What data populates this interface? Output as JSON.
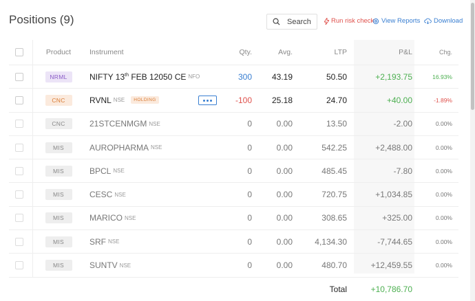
{
  "header": {
    "title": "Positions (9)",
    "search_label": "Search",
    "risk_label": "Run risk check",
    "reports_label": "View Reports",
    "download_label": "Download"
  },
  "columns": {
    "product": "Product",
    "instrument": "Instrument",
    "qty": "Qty.",
    "avg": "Avg.",
    "ltp": "LTP",
    "pnl": "P&L",
    "chg": "Chg."
  },
  "rows": [
    {
      "product": "NRML",
      "instrument": "NIFTY 13",
      "instrument_sup": "th",
      "instrument_rest": " FEB 12050 CE",
      "exchange": "NFO",
      "qty": "300",
      "avg": "43.19",
      "ltp": "50.50",
      "pnl": "+2,193.75",
      "chg": "16.93%"
    },
    {
      "product": "CNC",
      "instrument": "RVNL",
      "exchange": "NSE",
      "tag": "HOLDING",
      "qty": "-100",
      "avg": "25.18",
      "ltp": "24.70",
      "pnl": "+40.00",
      "chg": "-1.89%"
    },
    {
      "product": "CNC",
      "instrument": "21STCENMGM",
      "exchange": "NSE",
      "qty": "0",
      "avg": "0.00",
      "ltp": "13.50",
      "pnl": "-2.00",
      "chg": "0.00%"
    },
    {
      "product": "MIS",
      "instrument": "AUROPHARMA",
      "exchange": "NSE",
      "qty": "0",
      "avg": "0.00",
      "ltp": "542.25",
      "pnl": "+2,488.00",
      "chg": "0.00%"
    },
    {
      "product": "MIS",
      "instrument": "BPCL",
      "exchange": "NSE",
      "qty": "0",
      "avg": "0.00",
      "ltp": "485.45",
      "pnl": "-7.80",
      "chg": "0.00%"
    },
    {
      "product": "MIS",
      "instrument": "CESC",
      "exchange": "NSE",
      "qty": "0",
      "avg": "0.00",
      "ltp": "720.75",
      "pnl": "+1,034.85",
      "chg": "0.00%"
    },
    {
      "product": "MIS",
      "instrument": "MARICO",
      "exchange": "NSE",
      "qty": "0",
      "avg": "0.00",
      "ltp": "308.65",
      "pnl": "+325.00",
      "chg": "0.00%"
    },
    {
      "product": "MIS",
      "instrument": "SRF",
      "exchange": "NSE",
      "qty": "0",
      "avg": "0.00",
      "ltp": "4,134.30",
      "pnl": "-7,744.65",
      "chg": "0.00%"
    },
    {
      "product": "MIS",
      "instrument": "SUNTV",
      "exchange": "NSE",
      "qty": "0",
      "avg": "0.00",
      "ltp": "480.70",
      "pnl": "+12,459.55",
      "chg": "0.00%"
    }
  ],
  "footer": {
    "total_label": "Total",
    "total_value": "+10,786.70"
  },
  "colors": {
    "accent_blue": "#387ed1",
    "loss_red": "#df514c",
    "profit_green": "#4caf50",
    "nrml_purple": "#8a5bc7",
    "cnc_orange": "#d97a32"
  },
  "icons": {
    "search": "search-icon",
    "risk": "lightning-icon",
    "reports": "settings-gear-icon",
    "download": "cloud-download-icon",
    "more": "more-dots-icon"
  }
}
